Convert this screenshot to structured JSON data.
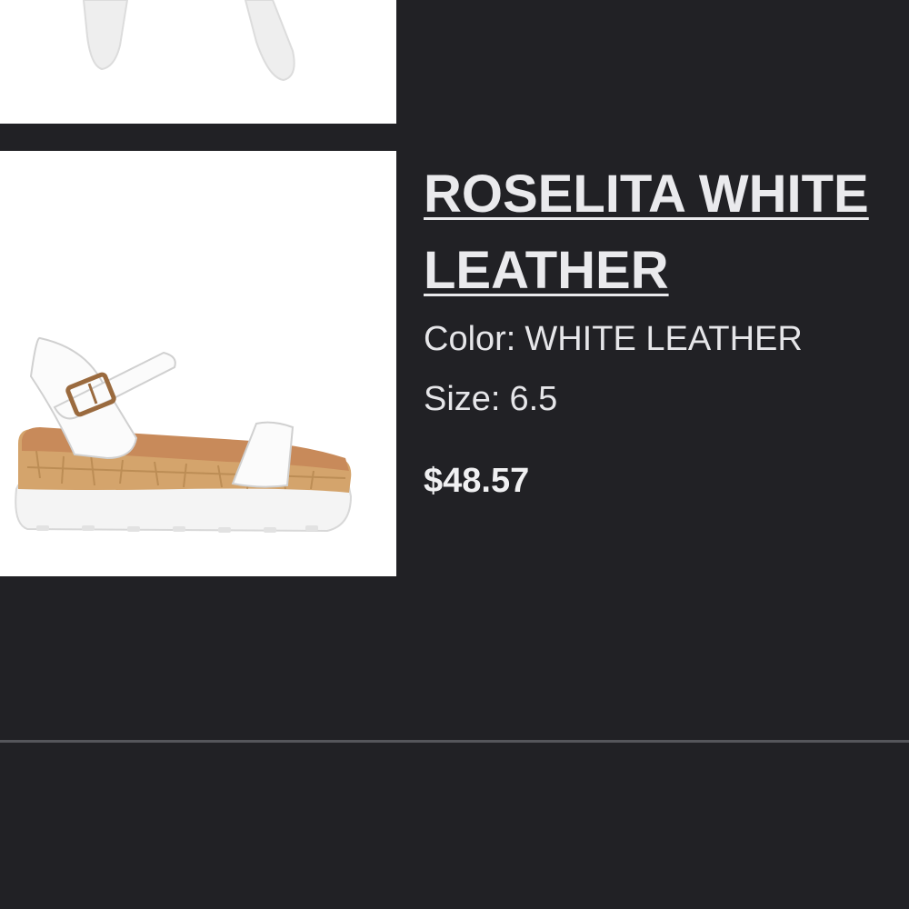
{
  "product": {
    "name_line1": "ROSELITA WHITE",
    "name_line2": "LEATHER",
    "color_label": "Color:",
    "color_value": "WHITE LEATHER",
    "size_label": "Size:",
    "size_value": "6.5",
    "price": "$48.57"
  },
  "colors": {
    "background": "#212125",
    "text": "#e6e6e9",
    "divider": "#55565b"
  }
}
